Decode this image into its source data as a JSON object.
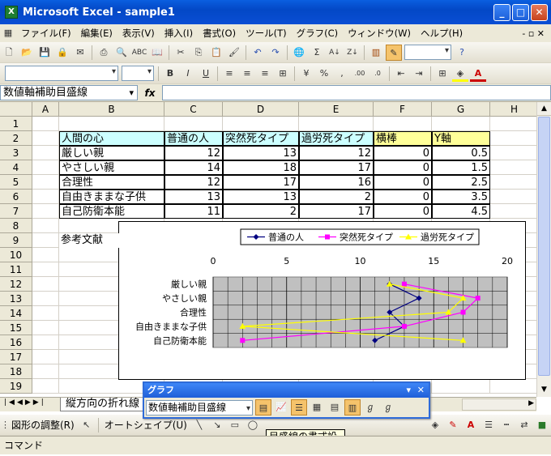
{
  "window": {
    "title": "Microsoft Excel - sample1",
    "icon": "X"
  },
  "menu": [
    "ファイル(F)",
    "編集(E)",
    "表示(V)",
    "挿入(I)",
    "書式(O)",
    "ツール(T)",
    "グラフ(C)",
    "ウィンドウ(W)",
    "ヘルプ(H)"
  ],
  "formula": {
    "namebox": "数値軸補助目盛線",
    "fx": "fx",
    "content": ""
  },
  "columns": [
    "A",
    "B",
    "C",
    "D",
    "E",
    "F",
    "G",
    "H"
  ],
  "rows": [
    "1",
    "2",
    "3",
    "4",
    "5",
    "6",
    "7",
    "8",
    "9",
    "10",
    "11",
    "12",
    "13",
    "14",
    "15",
    "16",
    "17",
    "18",
    "19"
  ],
  "table": {
    "headers": [
      "人間の心",
      "普通の人",
      "突然死タイプ",
      "過労死タイプ",
      "横棒",
      "Y軸"
    ],
    "rows": [
      [
        "厳しい親",
        "12",
        "13",
        "12",
        "0",
        "0.5"
      ],
      [
        "やさしい親",
        "14",
        "18",
        "17",
        "0",
        "1.5"
      ],
      [
        "合理性",
        "12",
        "17",
        "16",
        "0",
        "2.5"
      ],
      [
        "自由きままな子供",
        "13",
        "13",
        "2",
        "0",
        "3.5"
      ],
      [
        "自己防衛本能",
        "11",
        "2",
        "17",
        "0",
        "4.5"
      ]
    ]
  },
  "note": "参考文献",
  "sheet_tab": "縦方向の折れ線",
  "chart_data": {
    "type": "line",
    "orientation": "horizontal",
    "categories": [
      "厳しい親",
      "やさしい親",
      "合理性",
      "自由きままな子供",
      "自己防衛本能"
    ],
    "xlim": [
      0,
      20
    ],
    "xticks": [
      "0",
      "5",
      "10",
      "15",
      "20"
    ],
    "series": [
      {
        "name": "普通の人",
        "color": "#000080",
        "marker": "diamond",
        "values": [
          12,
          14,
          12,
          13,
          11
        ]
      },
      {
        "name": "突然死タイプ",
        "color": "#ff00ff",
        "marker": "square",
        "values": [
          13,
          18,
          17,
          13,
          2
        ]
      },
      {
        "name": "過労死タイプ",
        "color": "#ffff00",
        "marker": "triangle",
        "values": [
          12,
          17,
          16,
          2,
          17
        ]
      }
    ],
    "legend_position": "top",
    "plot_bg": "#c0c0c0",
    "grid": true
  },
  "chart_toolbar": {
    "title": "グラフ",
    "selector": "数値軸補助目盛線"
  },
  "tooltip": "目盛線の書式設定",
  "drawing": {
    "adjust": "図形の調整(R)",
    "autoshape": "オートシェイプ(U)"
  },
  "status": "コマンド",
  "toolbar_icons": [
    "new-icon",
    "open-icon",
    "save-icon",
    "permission-icon",
    "mail-icon",
    "print-icon",
    "preview-icon",
    "spell-icon",
    "research-icon",
    "cut-icon",
    "copy-icon",
    "paste-icon",
    "format-painter-icon",
    "undo-icon",
    "redo-icon",
    "hyperlink-icon",
    "autosum-icon",
    "sort-asc-icon",
    "sort-desc-icon",
    "chart-wizard-icon",
    "drawing-icon"
  ]
}
